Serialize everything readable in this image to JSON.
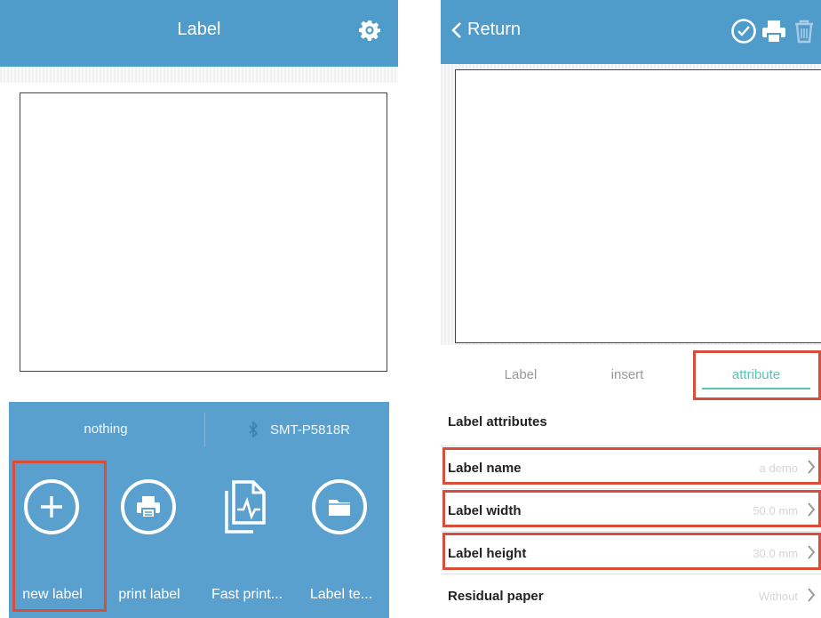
{
  "left_screen": {
    "header": {
      "title": "Label",
      "settings_icon": "gear-icon"
    },
    "printer_bar": {
      "template_name": "nothing",
      "bluetooth_icon": "bluetooth-icon",
      "printer_name": "SMT-P5818R"
    },
    "actions": [
      {
        "label": "new label",
        "icon": "plus-circle-icon"
      },
      {
        "label": "print label",
        "icon": "printer-circle-icon"
      },
      {
        "label": "Fast print...",
        "icon": "document-chart-icon"
      },
      {
        "label": "Label te...",
        "icon": "folder-circle-icon"
      }
    ]
  },
  "right_screen": {
    "header": {
      "back_label": "Return",
      "icons": [
        "check-circle-icon",
        "printer-icon",
        "trash-icon"
      ]
    },
    "tabs": [
      {
        "label": "Label",
        "active": false
      },
      {
        "label": "insert",
        "active": false
      },
      {
        "label": "attribute",
        "active": true
      }
    ],
    "section_title": "Label attributes",
    "rows": [
      {
        "label": "Label name",
        "value": "a demo"
      },
      {
        "label": "Label width",
        "value": "50.0 mm"
      },
      {
        "label": "Label height",
        "value": "30.0 mm"
      },
      {
        "label": "Residual paper",
        "value": "Without"
      }
    ]
  },
  "colors": {
    "header_blue": "#4f9ccb",
    "panel_blue": "#5aa0cf",
    "highlight_red": "#d94e3b",
    "tab_active": "#59c4b4"
  }
}
